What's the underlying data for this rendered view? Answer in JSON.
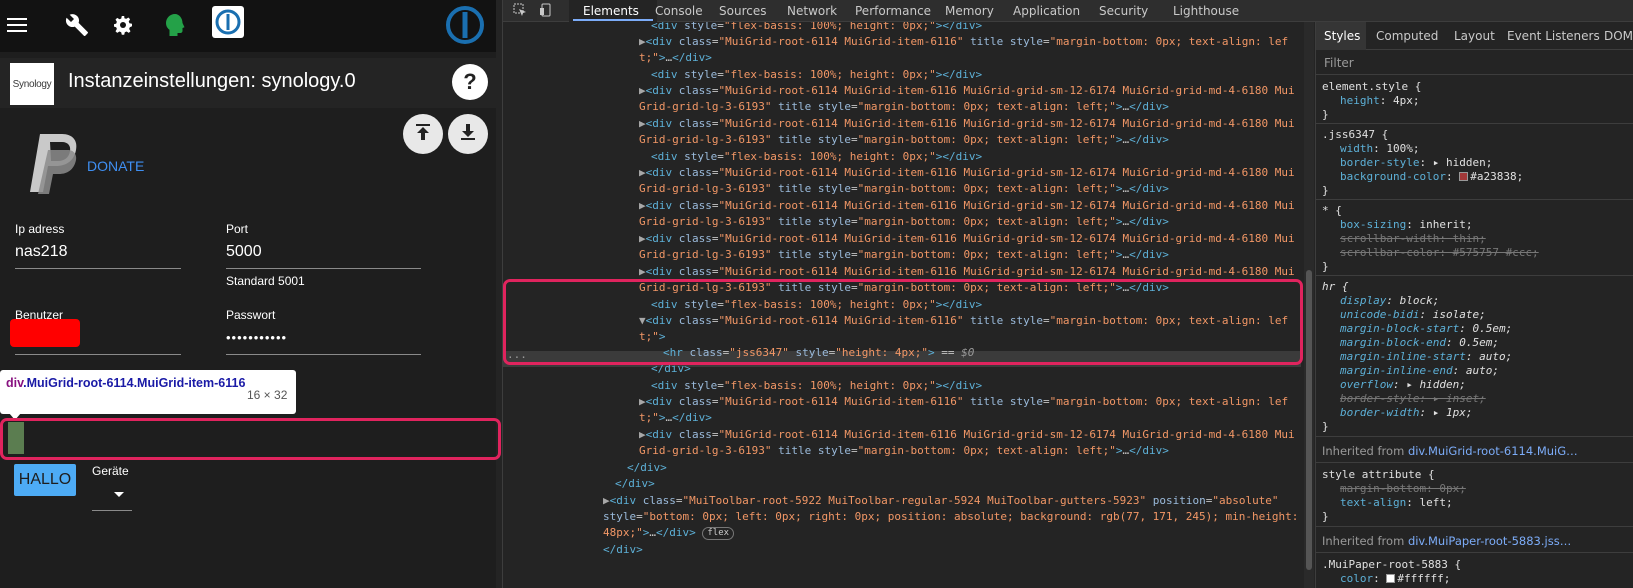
{
  "app": {
    "menu_icon": "hamburger-menu-icon",
    "toolbar_icons": [
      "wrench-icon",
      "gear-icon",
      "head-icon",
      "iobroker-icon"
    ],
    "instance_logo_text": "Synology",
    "title": "Instanzeinstellungen: synology.0",
    "help_label": "?",
    "donate_label": "DONATE",
    "fields": {
      "ip": {
        "label": "Ip adress",
        "value": "nas218"
      },
      "port": {
        "label": "Port",
        "value": "5000",
        "helper": "Standard 5001"
      },
      "user": {
        "label": "Benutzer"
      },
      "password": {
        "label": "Passwort",
        "value": "•••••••••••"
      }
    },
    "hallo_button": "HALLO",
    "devices_label": "Geräte"
  },
  "inspector_tooltip": {
    "tag": "div",
    "classes": ".MuiGrid-root-6114.MuiGrid-item-6116",
    "size": "16 × 32"
  },
  "devtools": {
    "tabs": [
      "Elements",
      "Console",
      "Sources",
      "Network",
      "Performance",
      "Memory",
      "Application",
      "Security",
      "Lighthouse"
    ],
    "active_tab": "Elements",
    "styles_tabs": [
      "Styles",
      "Computed",
      "Layout",
      "Event Listeners",
      "DOM"
    ],
    "filter_placeholder": "Filter",
    "inherited_1_label": "Inherited from",
    "inherited_1_src": "div.MuiGrid-root-6114.MuiG…",
    "inherited_2_label": "Inherited from",
    "inherited_2_src": "div.MuiPaper-root-5883.jss…",
    "colors": {
      "accent": "#e0245e",
      "tab_active": "#7cacf8",
      "swatch_jss": "#a23838"
    }
  }
}
